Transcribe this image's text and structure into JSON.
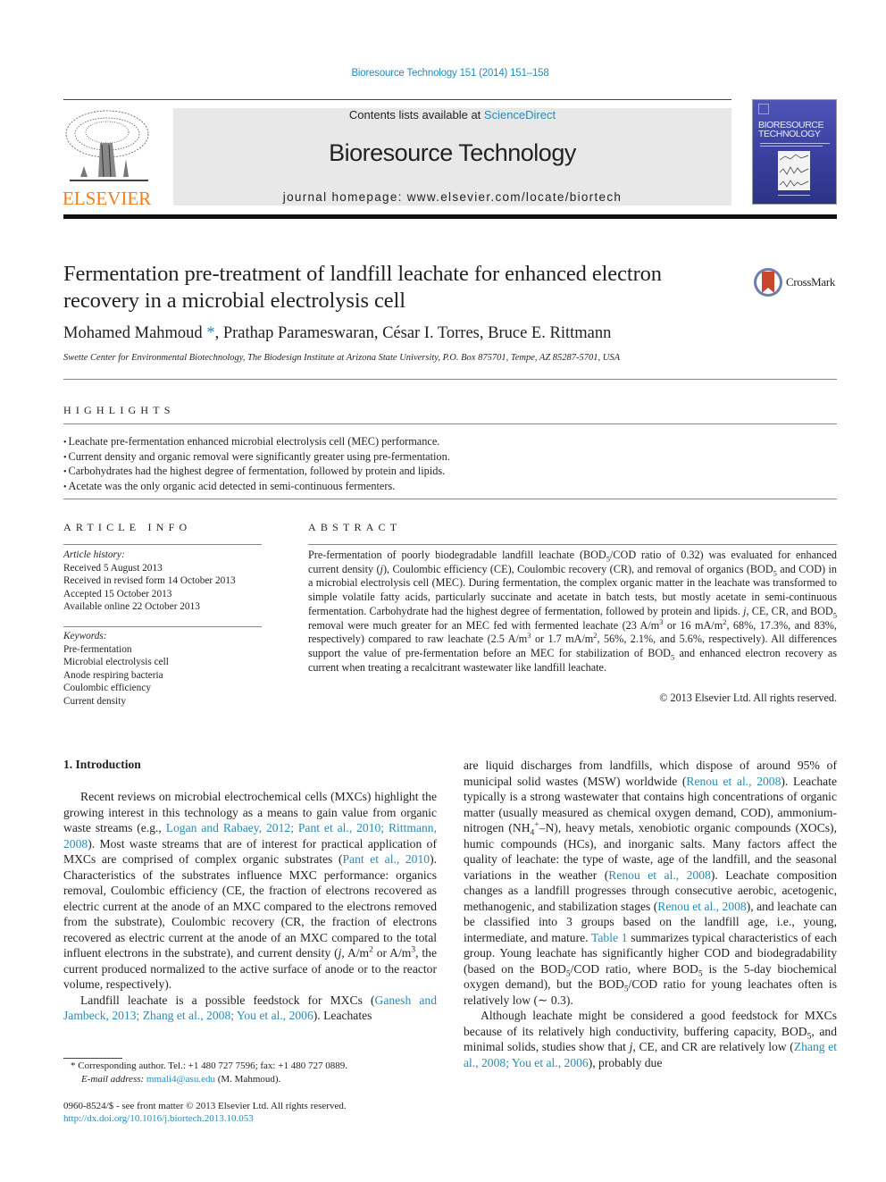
{
  "header": {
    "journal_citation": "Bioresource Technology 151 (2014) 151–158",
    "contents_prefix": "Contents lists available at ",
    "contents_link": "ScienceDirect",
    "journal_title": "Bioresource Technology",
    "homepage": "journal homepage: www.elsevier.com/locate/biortech",
    "publisher_logo_text": "ELSEVIER",
    "cover_title_line1": "BIORESOURCE",
    "cover_title_line2": "TECHNOLOGY",
    "colors": {
      "link": "#2a8bb5",
      "elsevier_orange": "#f07f1a",
      "banner_bg": "#e8e8e8",
      "cover_blue": "#3a3f9e"
    }
  },
  "article": {
    "title": "Fermentation pre-treatment of landfill leachate for enhanced electron recovery in a microbial electrolysis cell",
    "crossmark_label": "CrossMark",
    "authors": [
      {
        "name": "Mohamed Mahmoud",
        "mark": "*"
      },
      {
        "name": "Prathap Parameswaran",
        "mark": ""
      },
      {
        "name": "César I. Torres",
        "mark": ""
      },
      {
        "name": "Bruce E. Rittmann",
        "mark": ""
      }
    ],
    "authors_text_1": "Mohamed Mahmoud",
    "authors_star": " *",
    "authors_text_2": ", Prathap Parameswaran, César I. Torres, Bruce E. Rittmann",
    "affiliation": "Swette Center for Environmental Biotechnology, The Biodesign Institute at Arizona State University, P.O. Box 875701, Tempe, AZ 85287-5701, USA"
  },
  "highlights": {
    "heading": "HIGHLIGHTS",
    "items": [
      "Leachate pre-fermentation enhanced microbial electrolysis cell (MEC) performance.",
      "Current density and organic removal were significantly greater using pre-fermentation.",
      "Carbohydrates had the highest degree of fermentation, followed by protein and lipids.",
      "Acetate was the only organic acid detected in semi-continuous fermenters."
    ]
  },
  "article_info": {
    "heading": "ARTICLE INFO",
    "history_label": "Article history:",
    "history": [
      "Received 5 August 2013",
      "Received in revised form 14 October 2013",
      "Accepted 15 October 2013",
      "Available online 22 October 2013"
    ],
    "keywords_label": "Keywords:",
    "keywords": [
      "Pre-fermentation",
      "Microbial electrolysis cell",
      "Anode respiring bacteria",
      "Coulombic efficiency",
      "Current density"
    ]
  },
  "abstract": {
    "heading": "ABSTRACT",
    "p1": "Pre-fermentation of poorly biodegradable landfill leachate (BOD",
    "p2": "/COD ratio of 0.32) was evaluated for enhanced current density (",
    "p3": "), Coulombic efficiency (CE), Coulombic recovery (CR), and removal of organics (BOD",
    "p4": " and COD) in a microbial electrolysis cell (MEC). During fermentation, the complex organic matter in the leachate was transformed to simple volatile fatty acids, particularly succinate and acetate in batch tests, but mostly acetate in semi-continuous fermentation. Carbohydrate had the highest degree of fermentation, followed by protein and lipids. ",
    "p5": ", CE, CR, and BOD",
    "p6": " removal were much greater for an MEC fed with fermented leachate (23 A/m",
    "p7": " or 16 mA/m",
    "p8": ", 68%, 17.3%, and 83%, respectively) compared to raw leachate (2.5 A/m",
    "p9": " or 1.7 mA/m",
    "p10": ", 56%, 2.1%, and 5.6%, respectively). All differences support the value of pre-fermentation before an MEC for stabilization of BOD",
    "p11": " and enhanced electron recovery as current when treating a recalcitrant wastewater like landfill leachate.",
    "sub5": "5",
    "sup2": "2",
    "sup3": "3",
    "j": "j",
    "copyright": "© 2013 Elsevier Ltd. All rights reserved."
  },
  "intro": {
    "heading": "1. Introduction",
    "l1a": "Recent reviews on microbial electrochemical cells (MXCs) highlight the growing interest in this technology as a means to gain value from organic waste streams (e.g., ",
    "l1link": "Logan and Rabaey, 2012; Pant et al., 2010; Rittmann, 2008",
    "l1b": "). Most waste streams that are of interest for practical application of MXCs are comprised of complex organic substrates (",
    "l1link2": "Pant et al., 2010",
    "l1c": "). Characteristics of the substrates influence MXC performance: organics removal, Coulombic efficiency (CE, the fraction of electrons recovered as electric current at the anode of an MXC compared to the electrons removed from the substrate), Coulombic recovery (CR, the fraction of electrons recovered as electric current at the anode of an MXC compared to the total influent electrons in the substrate), and current density (",
    "l1j": "j",
    "l1d": ", A/m",
    "l1e": " or A/m",
    "l1f": ", the current produced normalized to the active surface of anode or to the reactor volume, respectively).",
    "l2a": "Landfill leachate is a possible feedstock for MXCs (",
    "l2link": "Ganesh and Jambeck, 2013; Zhang et al., 2008; You et al., 2006",
    "l2b": "). Leachates are liquid discharges from landfills, which dispose of around 95% of municipal solid wastes (MSW) worldwide (",
    "l2link2": "Renou et al., 2008",
    "l2c": "). Leachate typically is a strong wastewater that contains high concentrations of organic matter (usually measured as chemical oxygen demand, COD), ammonium-nitrogen (NH",
    "l2sub": "4",
    "l2sup": "+",
    "l2d": "–N), heavy metals, xenobiotic organic compounds (XOCs), humic compounds (HCs), and inorganic salts. Many factors affect the quality of leachate: the type of waste, age of the landfill, and the seasonal variations in the weather (",
    "l2link3": "Renou et al., 2008",
    "l2e": "). Leachate composition changes as a landfill progresses through consecutive aerobic, acetogenic, methanogenic, and stabilization stages (",
    "l2link4": "Renou et al., 2008",
    "l2f": "), and leachate can be classified into 3 groups based on the landfill age, i.e., young, intermediate, and mature. ",
    "l2link5": "Table 1",
    "l2g": " summarizes typical characteristics of each group. Young leachate has significantly higher COD and biodegradability (based on the BOD",
    "l2h": "/COD ratio, where BOD",
    "l2i": " is the 5-day biochemical oxygen demand), but the BOD",
    "l2k": "/COD ratio for young leachates often is relatively low (∼ 0.3).",
    "l3a": "Although leachate might be considered a good feedstock for MXCs because of its relatively high conductivity, buffering capacity, BOD",
    "l3b": ", and minimal solids, studies show that ",
    "l3j": "j",
    "l3c": ", CE, and CR are relatively low (",
    "l3link": "Zhang et al., 2008; You et al., 2006",
    "l3d": "), probably due"
  },
  "footnotes": {
    "corresponding": "* Corresponding author. Tel.: +1 480 727 7596; fax: +1 480 727 0889.",
    "email_label": "E-mail address: ",
    "email": "mmali4@asu.edu",
    "email_suffix": " (M. Mahmoud).",
    "issn": "0960-8524/$ - see front matter © 2013 Elsevier Ltd. All rights reserved.",
    "doi": "http://dx.doi.org/10.1016/j.biortech.2013.10.053"
  }
}
